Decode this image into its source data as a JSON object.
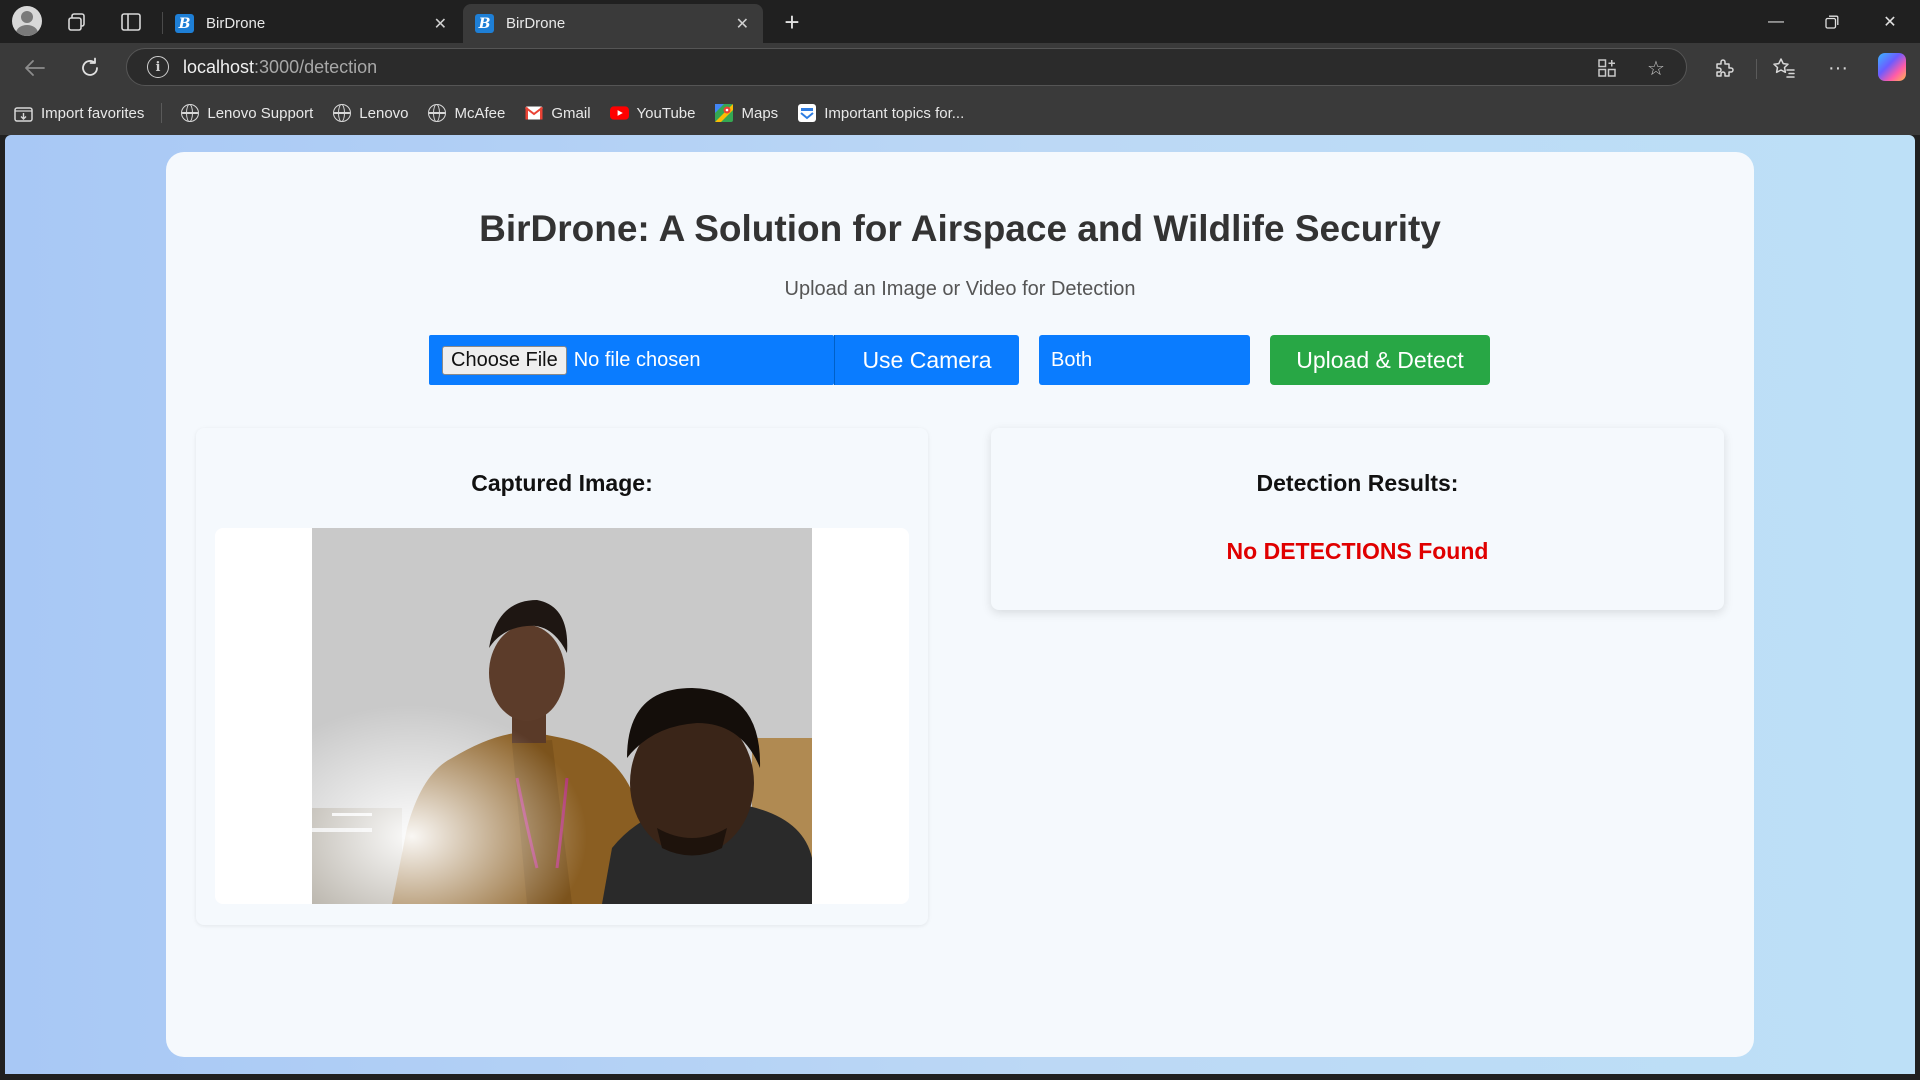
{
  "browser": {
    "tabs": [
      {
        "title": "BirDrone",
        "favicon": "B"
      },
      {
        "title": "BirDrone",
        "favicon": "B"
      }
    ],
    "url_host": "localhost",
    "url_path": ":3000/detection",
    "bookmarks": [
      {
        "label": "Import favorites",
        "icon": "import-icon"
      },
      {
        "label": "Lenovo Support",
        "icon": "globe-icon"
      },
      {
        "label": "Lenovo",
        "icon": "globe-icon"
      },
      {
        "label": "McAfee",
        "icon": "globe-icon"
      },
      {
        "label": "Gmail",
        "icon": "gmail-icon"
      },
      {
        "label": "YouTube",
        "icon": "youtube-icon"
      },
      {
        "label": "Maps",
        "icon": "maps-icon"
      },
      {
        "label": "Important topics for...",
        "icon": "bookmark-page-icon"
      }
    ]
  },
  "page": {
    "title": "BirDrone: A Solution for Airspace and Wildlife Security",
    "subtitle": "Upload an Image or Video for Detection",
    "file_button": "Choose File",
    "file_status": "No file chosen",
    "camera_button": "Use Camera",
    "mode_select": "Both",
    "upload_button": "Upload & Detect",
    "captured_heading": "Captured Image:",
    "results_heading": "Detection Results:",
    "results_message": "No DETECTIONS Found"
  },
  "colors": {
    "primary": "#0a7cff",
    "success": "#28a745",
    "error": "#e00000"
  }
}
